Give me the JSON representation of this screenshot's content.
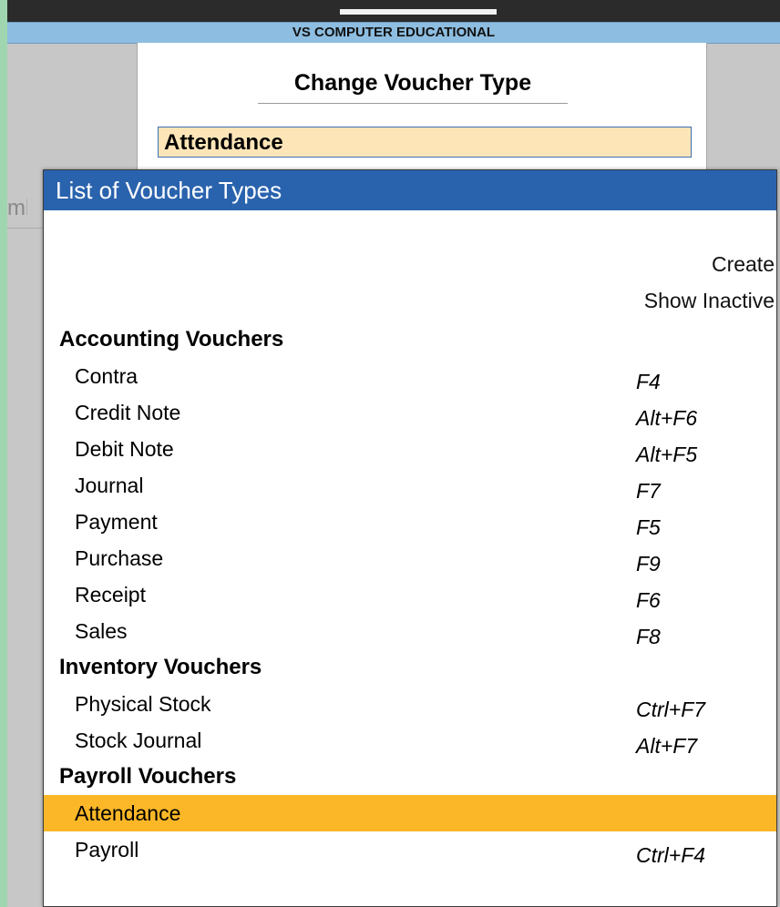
{
  "company": "VS COMPUTER EDUCATIONAL",
  "dialog": {
    "title": "Change Voucher Type",
    "value": "Attendance",
    "background_label_fragment": "mb"
  },
  "list": {
    "title": "List of Voucher Types",
    "actions": [
      "Create",
      "Show Inactive"
    ],
    "rows": [
      {
        "type": "group",
        "label": "Accounting Vouchers"
      },
      {
        "type": "item",
        "label": "Contra",
        "key": "F4"
      },
      {
        "type": "item",
        "label": "Credit Note",
        "key": "Alt+F6"
      },
      {
        "type": "item",
        "label": "Debit Note",
        "key": "Alt+F5"
      },
      {
        "type": "item",
        "label": "Journal",
        "key": "F7"
      },
      {
        "type": "item",
        "label": "Payment",
        "key": "F5"
      },
      {
        "type": "item",
        "label": "Purchase",
        "key": "F9"
      },
      {
        "type": "item",
        "label": "Receipt",
        "key": "F6"
      },
      {
        "type": "item",
        "label": "Sales",
        "key": "F8"
      },
      {
        "type": "group",
        "label": "Inventory Vouchers"
      },
      {
        "type": "item",
        "label": "Physical Stock",
        "key": "Ctrl+F7"
      },
      {
        "type": "item",
        "label": "Stock Journal",
        "key": "Alt+F7"
      },
      {
        "type": "group",
        "label": "Payroll Vouchers"
      },
      {
        "type": "item",
        "label": "Attendance",
        "key": "",
        "selected": true
      },
      {
        "type": "item",
        "label": "Payroll",
        "key": "Ctrl+F4"
      }
    ]
  },
  "colors": {
    "header_blue": "#2a63ad",
    "company_bar": "#8dbde0",
    "input_fill": "#fde5b7",
    "selection": "#fbb727"
  }
}
